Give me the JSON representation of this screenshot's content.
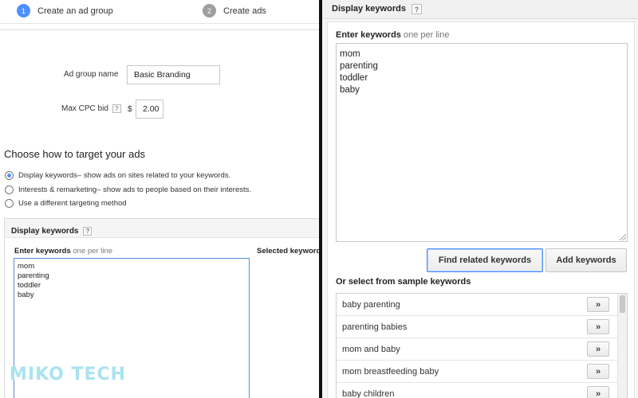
{
  "steps": [
    {
      "num": "1",
      "label": "Create an ad group"
    },
    {
      "num": "2",
      "label": "Create ads"
    }
  ],
  "form": {
    "ad_group_label": "Ad group name",
    "ad_group_value": "Basic Branding",
    "cpc_label": "Max CPC bid",
    "cpc_currency": "$",
    "cpc_value": "2.00",
    "help_glyph": "?"
  },
  "targeting": {
    "title": "Choose how to target your ads",
    "options": [
      {
        "label": "Display keywords",
        "desc": " – show ads on sites related to your keywords.",
        "selected": true
      },
      {
        "label": "Interests & remarketing",
        "desc": " – show ads to people based on their interests.",
        "selected": false
      },
      {
        "label": "Use a different targeting method",
        "desc": "",
        "selected": false
      }
    ]
  },
  "left_keywords": {
    "header": "Display keywords",
    "enter_label": "Enter keywords",
    "enter_hint": " one per line",
    "selected_label": "Selected keywords",
    "lines": [
      "mom",
      "parenting",
      "toddler",
      "baby"
    ]
  },
  "right_keywords": {
    "header": "Display keywords",
    "enter_label": "Enter keywords",
    "enter_hint": " one per line",
    "lines": [
      "mom",
      "parenting",
      "toddler",
      "baby"
    ],
    "find_button": "Find related keywords",
    "add_button": "Add keywords",
    "sample_label": "Or select from sample keywords",
    "samples": [
      "baby parenting",
      "parenting babies",
      "mom and baby",
      "mom breastfeeding baby",
      "baby children"
    ],
    "arrow_glyph": "»"
  },
  "watermark": "MIKO TECH",
  "colors": {
    "accent": "#4d90fe",
    "step_inactive": "#9e9e9e",
    "watermark": "#a9e3ef"
  }
}
